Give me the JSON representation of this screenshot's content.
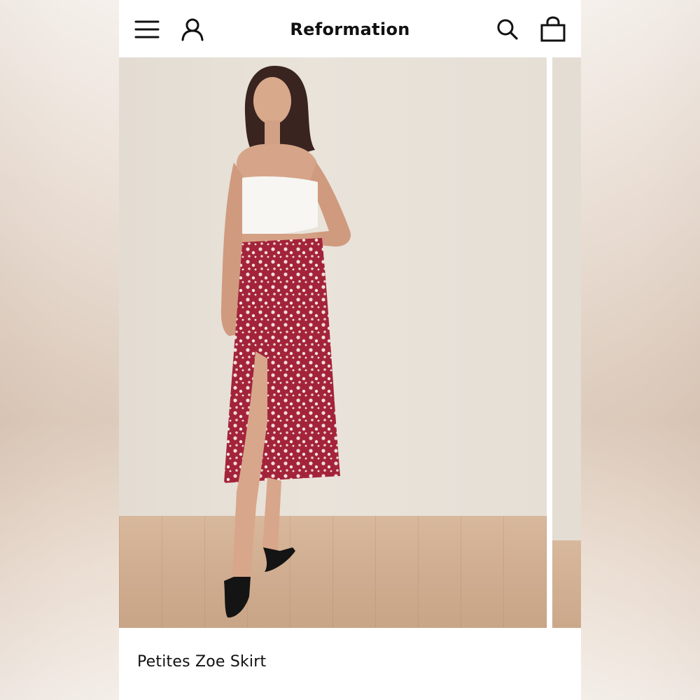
{
  "header": {
    "brand": "Reformation",
    "icons": [
      "menu-icon",
      "account-icon",
      "search-icon",
      "bag-icon"
    ]
  },
  "product": {
    "title": "Petites Zoe Skirt"
  },
  "colors": {
    "background": "#ffffff",
    "text": "#111111",
    "skirt": "#a3243a",
    "wall": "#e6dfd6",
    "floor": "#d3b194"
  }
}
